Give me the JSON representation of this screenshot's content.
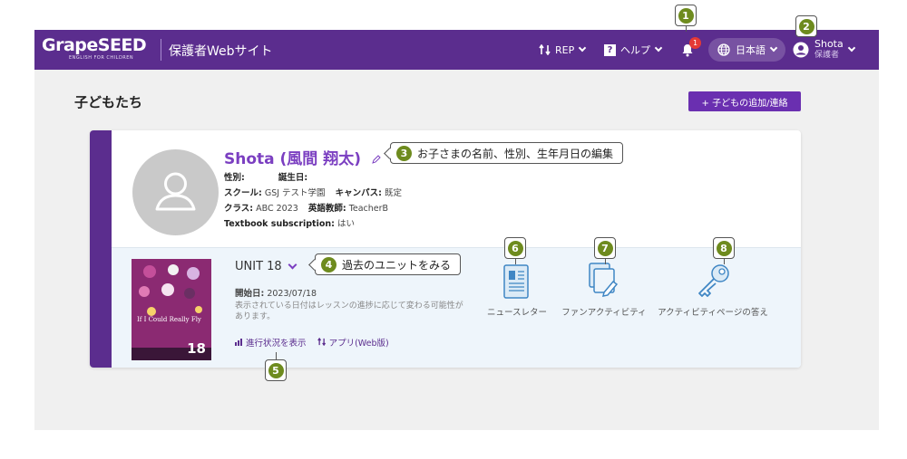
{
  "header": {
    "logo": "GrapeSEED",
    "logo_sub": "ENGLISH FOR CHILDREN",
    "site_title": "保護者Webサイト",
    "rep_label": "REP",
    "help_label": "ヘルプ",
    "notification_count": "1",
    "language": "日本語",
    "user_name": "Shota",
    "user_role": "保護者"
  },
  "page": {
    "title": "子どもたち",
    "add_button": "+ 子どもの追加/連絡"
  },
  "child": {
    "name": "Shota (風間 翔太)",
    "gender_label": "性別:",
    "gender_value": "",
    "birthday_label": "誕生日:",
    "birthday_value": "",
    "school_label": "スクール:",
    "school_value": "GSJ テスト学園",
    "campus_label": "キャンパス:",
    "campus_value": "既定",
    "class_label": "クラス:",
    "class_value": "ABC 2023",
    "teacher_label": "英語教師:",
    "teacher_value": "TeacherB",
    "subscription_label": "Textbook subscription:",
    "subscription_value": "はい"
  },
  "unit": {
    "label": "UNIT 18",
    "start_label": "開始日:",
    "start_value": "2023/07/18",
    "note": "表示されている日付はレッスンの進捗に応じて変わる可能性があります。",
    "progress_link": "進行状況を表示",
    "app_link": "アプリ(Web版)",
    "book_title": "If I Could Really Fly",
    "book_number": "18"
  },
  "tools": {
    "newsletter": "ニュースレター",
    "fan_activity": "ファンアクティビティ",
    "answers": "アクティビティページの答え"
  },
  "annotations": {
    "n1": "1",
    "n2": "2",
    "n3": "3",
    "n3_text": "お子さまの名前、性別、生年月日の編集",
    "n4": "4",
    "n4_text": "過去のユニットをみる",
    "n5": "5",
    "n6": "6",
    "n7": "7",
    "n8": "8"
  },
  "colors": {
    "header": "#5b2d8e",
    "accent": "#7b3fc1",
    "marker": "#6e8b1e",
    "badge": "#e53935"
  }
}
